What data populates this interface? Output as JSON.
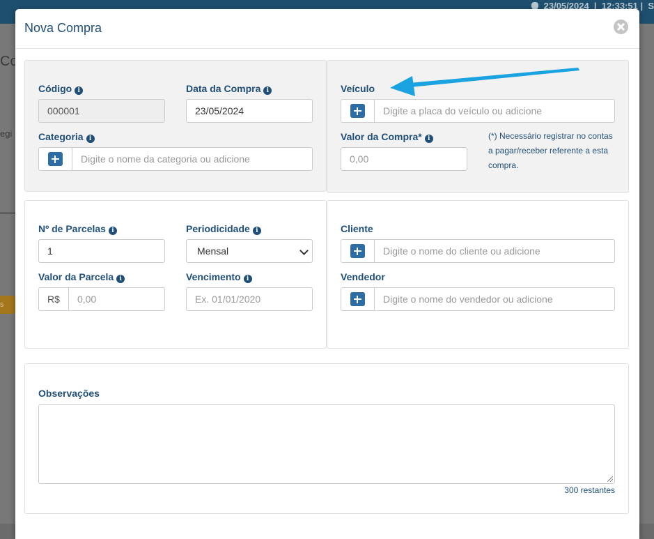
{
  "background": {
    "topbar_date": "23/05/2024",
    "topbar_time": "12:33:51",
    "topbar_user_initial": "S",
    "page_title_fragment": "Co",
    "field_fragment": "egi",
    "button_fragment": "s"
  },
  "modal": {
    "title": "Nova Compra",
    "codigo": {
      "label": "Código",
      "value": "000001"
    },
    "data_compra": {
      "label": "Data da Compra",
      "value": "23/05/2024"
    },
    "categoria": {
      "label": "Categoria",
      "placeholder": "Digite o nome da categoria ou adicione"
    },
    "veiculo": {
      "label": "Veículo",
      "placeholder": "Digite a placa do veículo ou adicione"
    },
    "valor_compra": {
      "label": "Valor da Compra*",
      "placeholder": "0,00"
    },
    "note_lines": [
      "(*) Necessário registrar no contas",
      "a pagar/receber referente a esta",
      "compra."
    ],
    "parcelas": {
      "label": "Nº de Parcelas",
      "value": "1"
    },
    "periodicidade": {
      "label": "Periodicidade",
      "selected": "Mensal"
    },
    "valor_parcela": {
      "label": "Valor da Parcela",
      "currency": "R$",
      "placeholder": "0,00"
    },
    "vencimento": {
      "label": "Vencimento",
      "placeholder": "Ex. 01/01/2020"
    },
    "cliente": {
      "label": "Cliente",
      "placeholder": "Digite o nome do cliente ou adicione"
    },
    "vendedor": {
      "label": "Vendedor",
      "placeholder": "Digite o nome do vendedor ou adicione"
    },
    "observacoes": {
      "label": "Observações",
      "counter": "300 restantes"
    }
  },
  "colors": {
    "accent": "#1f4e79",
    "plus_button": "#2e6da4",
    "annotation_arrow": "#1aa3e0"
  }
}
